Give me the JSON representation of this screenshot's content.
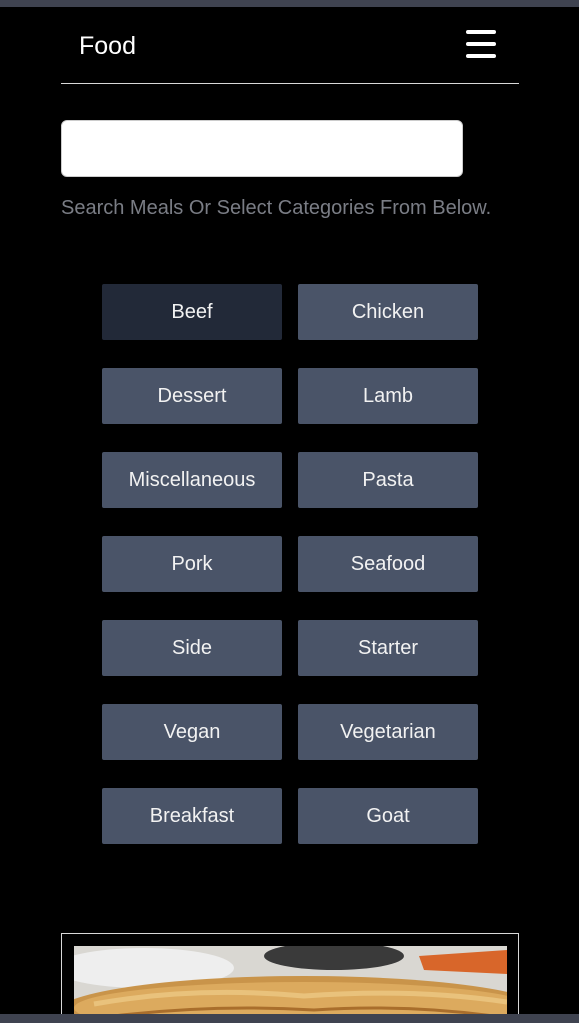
{
  "header": {
    "brand": "Food",
    "menu_icon": "hamburger-menu-icon"
  },
  "search": {
    "value": "",
    "placeholder": "",
    "helper_text": "Search Meals Or Select Categories From Below."
  },
  "categories": [
    {
      "label": "Beef",
      "active": true
    },
    {
      "label": "Chicken",
      "active": false
    },
    {
      "label": "Dessert",
      "active": false
    },
    {
      "label": "Lamb",
      "active": false
    },
    {
      "label": "Miscellaneous",
      "active": false
    },
    {
      "label": "Pasta",
      "active": false
    },
    {
      "label": "Pork",
      "active": false
    },
    {
      "label": "Seafood",
      "active": false
    },
    {
      "label": "Side",
      "active": false
    },
    {
      "label": "Starter",
      "active": false
    },
    {
      "label": "Vegan",
      "active": false
    },
    {
      "label": "Vegetarian",
      "active": false
    },
    {
      "label": "Breakfast",
      "active": false
    },
    {
      "label": "Goat",
      "active": false
    }
  ],
  "colors": {
    "background": "#000000",
    "category_button": "#4a5468",
    "category_button_active": "#222938",
    "helper_text": "#7a7d85"
  }
}
